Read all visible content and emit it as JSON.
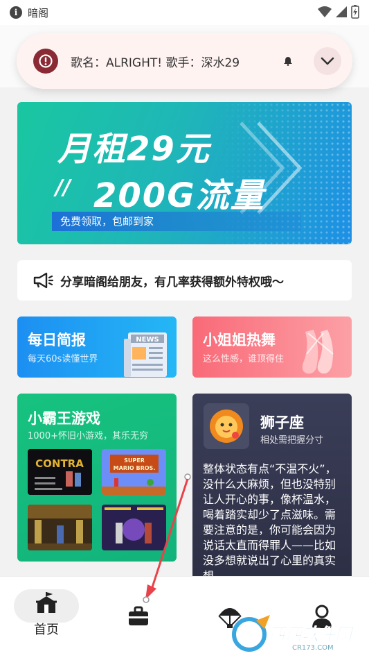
{
  "status_bar": {
    "app_name": "暗阁",
    "info_icon": "info-icon",
    "icons": [
      "wifi-icon",
      "signal-icon",
      "battery-charging-icon"
    ]
  },
  "notification": {
    "text": "歌名：ALRIGHT! 歌手：深水29",
    "icon": "alert-icon",
    "bell_icon": "bell-icon",
    "expand_icon": "chevron-down-icon"
  },
  "banner": {
    "title_line1": "月租29元",
    "title_line2": "200G流量",
    "slash_deco": "//",
    "tag": "免费领取，包邮到家"
  },
  "share": {
    "icon": "megaphone-icon",
    "text": "分享暗阁给朋友，有几率获得额外特权哦～"
  },
  "cards": {
    "news": {
      "title": "每日简报",
      "subtitle": "每天60s读懂世界",
      "icon": "newspaper-icon",
      "badge": "NEWS"
    },
    "dance": {
      "title": "小姐姐热舞",
      "subtitle": "这么性感，谁顶得住",
      "icon": "ballet-shoe-icon"
    },
    "games": {
      "title": "小霸王游戏",
      "subtitle": "1000+怀旧小游戏，其乐无穷",
      "thumbs": [
        {
          "name": "contra-thumb",
          "label": "CONTRA"
        },
        {
          "name": "mario-thumb",
          "label": "SUPER MARIO BROS."
        },
        {
          "name": "fighter-thumb",
          "label": ""
        },
        {
          "name": "kof-thumb",
          "label": ""
        }
      ]
    },
    "zodiac": {
      "title": "狮子座",
      "subtitle": "相处需把握分寸",
      "avatar": "lion-mascot-icon",
      "description": "整体状态有点“不温不火”，没什么大麻烦，但也没特别让人开心的事，像杯温水，喝着踏实却少了点滋味。需要注意的是，你可能会因为说话太直而得罪人——比如没多想就说出了心里的真实想"
    }
  },
  "bottom_nav": {
    "items": [
      {
        "label": "首页",
        "icon": "home-tent-icon"
      },
      {
        "label": "",
        "icon": "toolbox-icon"
      },
      {
        "label": "",
        "icon": "parachute-icon"
      },
      {
        "label": "",
        "icon": "person-icon"
      }
    ]
  },
  "watermark": {
    "text": "西西软件园",
    "sub": "CR173.COM"
  },
  "colors": {
    "banner_start": "#19c7a0",
    "banner_end": "#1e8fe6",
    "news": "#1c8ff2",
    "dance": "#f96a78",
    "games": "#17c27f",
    "zodiac": "#3b3e58",
    "notif_alert": "#8a2a35",
    "annotation_arrow": "#e8434a"
  }
}
